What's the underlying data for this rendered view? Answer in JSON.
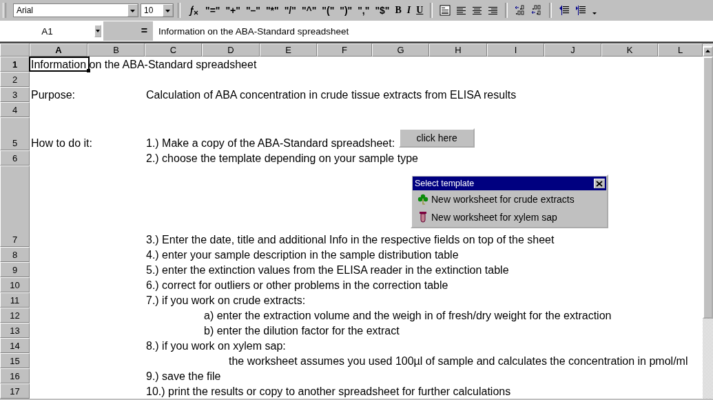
{
  "toolbar": {
    "font": "Arial",
    "font_size": "10",
    "quote_buttons": [
      "\"=\"",
      "\"+\"",
      "\"–\"",
      "\"*\"",
      "\"/\"",
      "\"^\"",
      "\"(\"",
      "\")\"",
      "\",\"",
      "\"$\""
    ],
    "style_buttons": [
      "B",
      "I",
      "U"
    ]
  },
  "formula_bar": {
    "name_box": "A1",
    "equals": "=",
    "content": "Information on the ABA-Standard spreadsheet"
  },
  "columns": [
    {
      "label": "A",
      "selected": true
    },
    {
      "label": "B",
      "selected": false
    },
    {
      "label": "C",
      "selected": false
    },
    {
      "label": "D",
      "selected": false
    },
    {
      "label": "E",
      "selected": false
    },
    {
      "label": "F",
      "selected": false
    },
    {
      "label": "G",
      "selected": false
    },
    {
      "label": "H",
      "selected": false
    },
    {
      "label": "I",
      "selected": false
    },
    {
      "label": "J",
      "selected": false
    },
    {
      "label": "K",
      "selected": false
    },
    {
      "label": "L",
      "selected": false
    }
  ],
  "rows": [
    {
      "number": "1",
      "selected": true,
      "cells": [
        {
          "kind": "label",
          "text": "Information on the ABA-Standard spreadsheet",
          "selected": true
        }
      ]
    },
    {
      "number": "2",
      "selected": false,
      "cells": []
    },
    {
      "number": "3",
      "selected": false,
      "cells": [
        {
          "kind": "label",
          "text": "Purpose:",
          "selected": false
        },
        {
          "kind": "step",
          "text": "Calculation of ABA concentration in crude tissue extracts from ELISA results",
          "selected": false
        }
      ]
    },
    {
      "number": "4",
      "selected": false,
      "cells": []
    },
    {
      "number": "5",
      "selected": false,
      "cells": [
        {
          "kind": "label",
          "text": "How to do it:",
          "selected": false
        },
        {
          "kind": "step",
          "text": "1.) Make a copy of the ABA-Standard spreadsheet:",
          "selected": false,
          "button": "click here"
        }
      ]
    },
    {
      "number": "6",
      "selected": false,
      "cells": [
        {
          "kind": "step",
          "text": "2.) choose  the template depending on your sample type",
          "selected": false
        }
      ]
    },
    {
      "number": "7",
      "selected": false,
      "cells": [
        {
          "kind": "step",
          "text": "3.) Enter the date, title and additional Info in the respective fields on top of the sheet",
          "selected": false
        }
      ]
    },
    {
      "number": "8",
      "selected": false,
      "cells": [
        {
          "kind": "step",
          "text": "4.) enter your sample description in the sample distribution table",
          "selected": false
        }
      ]
    },
    {
      "number": "9",
      "selected": false,
      "cells": [
        {
          "kind": "step",
          "text": "5.) enter the extinction values from the ELISA reader in the extinction table",
          "selected": false
        }
      ]
    },
    {
      "number": "10",
      "selected": false,
      "cells": [
        {
          "kind": "step",
          "text": "6.) correct for outliers or other problems in the correction table",
          "selected": false
        }
      ]
    },
    {
      "number": "11",
      "selected": false,
      "cells": [
        {
          "kind": "step",
          "text": "7.) if you work on crude extracts:",
          "selected": false
        }
      ]
    },
    {
      "number": "12",
      "selected": false,
      "cells": [
        {
          "kind": "indented",
          "text": "a) enter the extraction volume and the weigh in of fresh/dry weight for the extraction",
          "selected": false
        }
      ]
    },
    {
      "number": "13",
      "selected": false,
      "cells": [
        {
          "kind": "indented",
          "text": "b) enter the dilution factor for the extract",
          "selected": false
        }
      ]
    },
    {
      "number": "14",
      "selected": false,
      "cells": [
        {
          "kind": "step",
          "text": "8.) if you work on xylem sap:",
          "selected": false
        }
      ]
    },
    {
      "number": "15",
      "selected": false,
      "cells": [
        {
          "kind": "note",
          "text": "the worksheet assumes you used 100µl of sample and calculates the concentration in pmol/ml",
          "selected": false
        }
      ]
    },
    {
      "number": "16",
      "selected": false,
      "cells": [
        {
          "kind": "step",
          "text": "9.) save the file",
          "selected": false
        }
      ]
    },
    {
      "number": "17",
      "selected": false,
      "cells": [
        {
          "kind": "step",
          "text": "10.) print the results or copy to another spreadsheet for further calculations",
          "selected": false
        }
      ]
    }
  ],
  "template_dialog": {
    "title": "Select template",
    "items": [
      {
        "kind": "crude",
        "label": "New worksheet for crude extracts"
      },
      {
        "kind": "xylem",
        "label": "New worksheet for xylem sap"
      }
    ]
  }
}
